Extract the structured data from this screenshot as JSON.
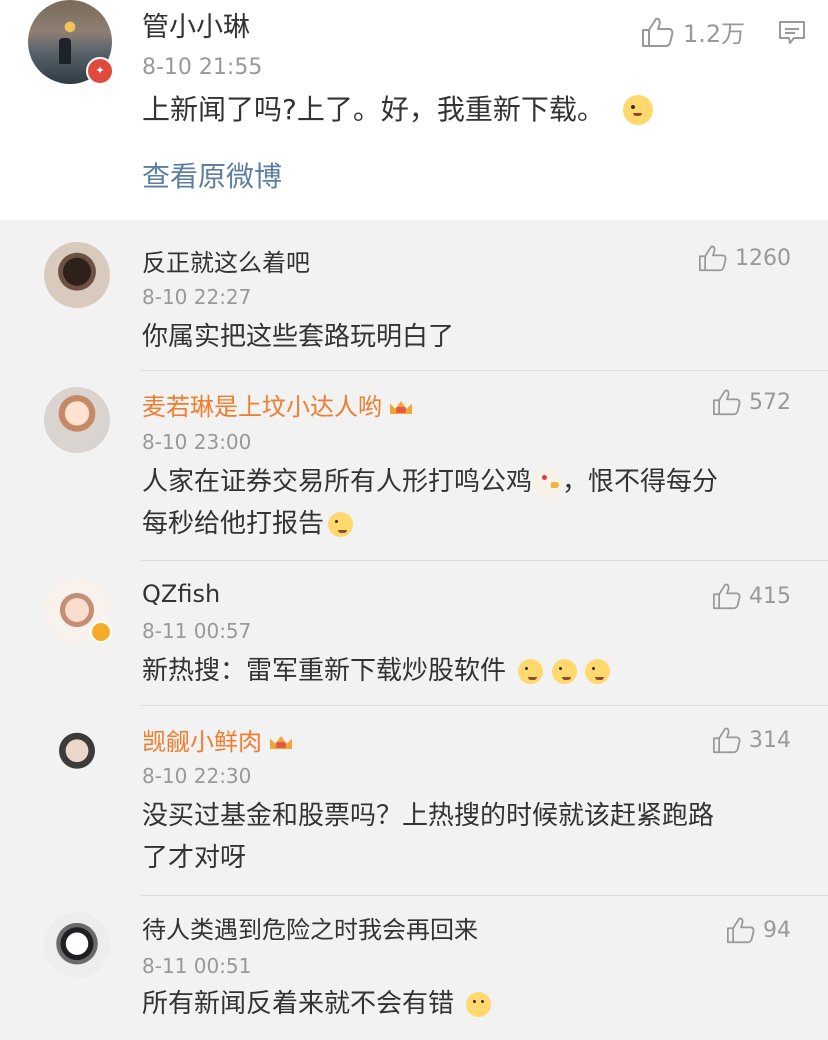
{
  "main": {
    "username": "管小小琳",
    "timestamp": "8-10 21:55",
    "text": "上新闻了吗?上了。好，我重新下载。",
    "likes": "1.2万",
    "link": "查看原微博"
  },
  "comments": [
    {
      "username": "反正就这么着吧",
      "timestamp": "8-10 22:27",
      "text": "你属实把这些套路玩明白了",
      "likes": "1260"
    },
    {
      "username": "麦若琳是上坟小达人哟",
      "timestamp": "8-10 23:00",
      "line1": "人家在证券交易所有人形打鸣公鸡",
      "line1_suffix": "，恨不得每分",
      "line2": "每秒给他打报告",
      "likes": "572"
    },
    {
      "username": "QZfish",
      "timestamp": "8-11 00:57",
      "text": "新热搜：雷军重新下载炒股软件",
      "likes": "415"
    },
    {
      "username": "觊觎小鲜肉",
      "timestamp": "8-10 22:30",
      "line1": "没买过基金和股票吗？上热搜的时候就该赶紧跑路",
      "line2": "了才对呀",
      "likes": "314"
    },
    {
      "username": "待人类遇到危险之时我会再回来",
      "timestamp": "8-11 00:51",
      "text": "所有新闻反着来就不会有错",
      "likes": "94"
    }
  ],
  "icons": {
    "like": "thumbs-up-icon",
    "comment": "comment-bubble-icon",
    "verified": "verified-badge-icon",
    "crown": "member-crown-icon"
  },
  "colors": {
    "link": "#5c7ea3",
    "vip_name": "#ef7d2e",
    "meta": "#999999"
  }
}
